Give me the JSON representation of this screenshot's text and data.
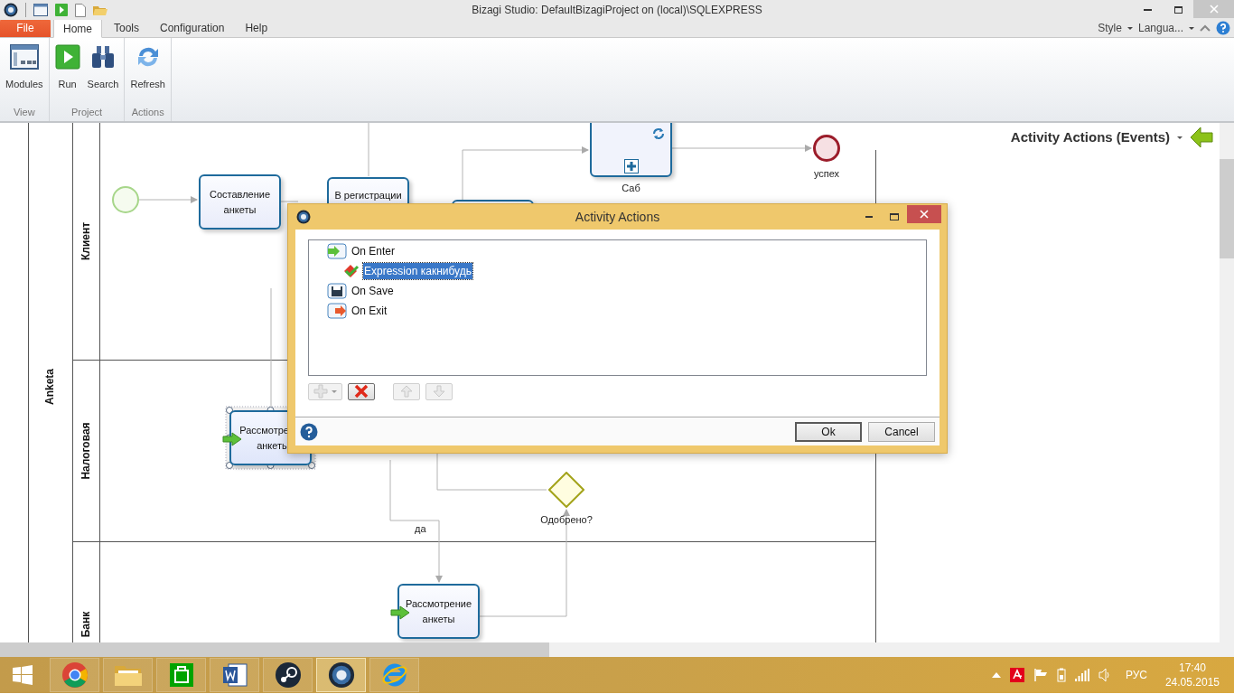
{
  "window": {
    "title": "Bizagi Studio: DefaultBizagiProject on (local)\\SQLEXPRESS"
  },
  "ribbon": {
    "tabs": [
      {
        "label": "File",
        "kind": "file",
        "selected": false
      },
      {
        "label": "Home",
        "kind": "tab",
        "selected": true
      },
      {
        "label": "Tools",
        "kind": "tab",
        "selected": false
      },
      {
        "label": "Configuration",
        "kind": "tab",
        "selected": false
      },
      {
        "label": "Help",
        "kind": "tab",
        "selected": false
      }
    ],
    "right_menus": [
      "Style",
      "Langua..."
    ],
    "groups": [
      {
        "label": "View",
        "buttons": [
          {
            "label": "Modules",
            "kind": "modules"
          }
        ]
      },
      {
        "label": "Project",
        "buttons": [
          {
            "label": "Run",
            "kind": "run"
          },
          {
            "label": "Search",
            "kind": "search"
          }
        ]
      },
      {
        "label": "Actions",
        "buttons": [
          {
            "label": "Refresh",
            "kind": "refresh"
          }
        ]
      }
    ]
  },
  "canvas": {
    "pool": "Anketa",
    "lanes": [
      {
        "name": "Клиент"
      },
      {
        "name": "Налоговая"
      },
      {
        "name": "Банк"
      }
    ],
    "nodes": [
      {
        "kind": "start",
        "selected": false
      },
      {
        "kind": "task",
        "lines": [
          "Составление",
          "анкеты"
        ],
        "enter_action": false,
        "selected": false
      },
      {
        "kind": "task",
        "lines": [
          "В регистрации"
        ],
        "enter_action": false,
        "selected": false
      },
      {
        "kind": "task",
        "selected": false
      },
      {
        "kind": "subprocess",
        "label": "Саб",
        "selected": false
      },
      {
        "kind": "end",
        "label": "успех",
        "selected": false
      },
      {
        "kind": "task",
        "lines": [
          "Рассмотре",
          "анкеты"
        ],
        "enter_action": true,
        "selected": true
      },
      {
        "kind": "gateway",
        "label": "Одобрено?",
        "selected": false
      },
      {
        "kind": "task",
        "lines": [
          "Рассмотрение",
          "анкеты"
        ],
        "enter_action": true,
        "selected": false
      }
    ],
    "edge_labels": [
      "да"
    ]
  },
  "side_panel": {
    "title": "Activity Actions (Events)"
  },
  "dialog": {
    "title": "Activity Actions",
    "tree": [
      {
        "label": "On Enter",
        "kind": "enter",
        "selected": false,
        "children": [
          {
            "label": "Expression какнибудь",
            "kind": "expression",
            "selected": true
          }
        ]
      },
      {
        "label": "On Save",
        "kind": "save",
        "selected": false
      },
      {
        "label": "On Exit",
        "kind": "exit",
        "selected": false
      }
    ],
    "toolbar": [
      {
        "kind": "add",
        "disabled": true
      },
      {
        "kind": "delete",
        "disabled": false
      },
      {
        "kind": "up",
        "disabled": true
      },
      {
        "kind": "down",
        "disabled": true
      }
    ],
    "buttons": [
      {
        "label": "Ok",
        "default": true
      },
      {
        "label": "Cancel",
        "default": false
      }
    ]
  },
  "taskbar": {
    "apps": [
      {
        "kind": "chrome",
        "active": false
      },
      {
        "kind": "explorer",
        "active": false
      },
      {
        "kind": "store",
        "active": false
      },
      {
        "kind": "word",
        "active": false
      },
      {
        "kind": "steam",
        "active": false
      },
      {
        "kind": "bizagi",
        "active": true
      },
      {
        "kind": "ie",
        "active": false
      }
    ],
    "language": "РУС",
    "time": "17:40",
    "date": "24.05.2015"
  }
}
